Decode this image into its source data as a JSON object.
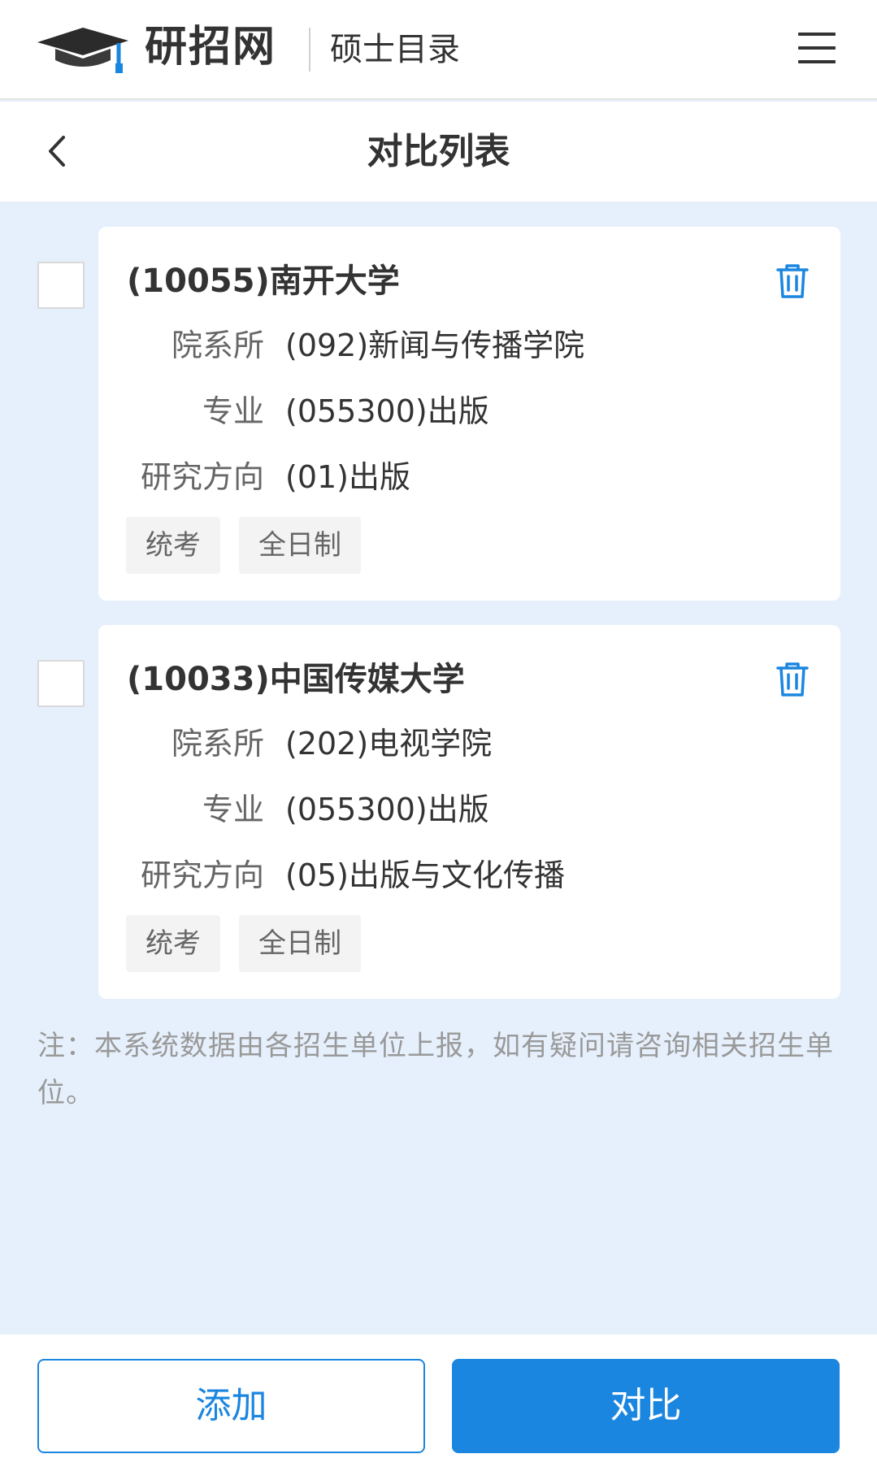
{
  "header": {
    "brand": "研招网",
    "section": "硕士目录"
  },
  "titlebar": {
    "title": "对比列表"
  },
  "fields": {
    "department": "院系所",
    "major": "专业",
    "direction": "研究方向"
  },
  "items": [
    {
      "school": "(10055)南开大学",
      "department": "(092)新闻与传播学院",
      "major": "(055300)出版",
      "direction": "(01)出版",
      "tags": [
        "统考",
        "全日制"
      ],
      "checked": false
    },
    {
      "school": "(10033)中国传媒大学",
      "department": "(202)电视学院",
      "major": "(055300)出版",
      "direction": "(05)出版与文化传播",
      "tags": [
        "统考",
        "全日制"
      ],
      "checked": false
    }
  ],
  "note": "注：本系统数据由各招生单位上报，如有疑问请咨询相关招生单位。",
  "buttons": {
    "add": "添加",
    "compare": "对比"
  },
  "colors": {
    "accent": "#1b86e0",
    "background": "#e6f0fc"
  },
  "icons": {
    "logo": "graduation-cap-icon",
    "menu": "hamburger-menu-icon",
    "back": "chevron-left-icon",
    "delete": "trash-icon"
  }
}
